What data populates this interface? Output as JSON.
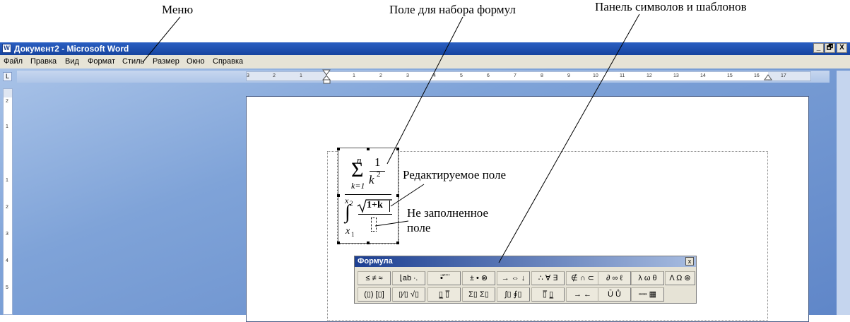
{
  "captions": {
    "menu": "Меню",
    "formula_field": "Поле для набора формул",
    "symbols_panel": "Панель символов и шаблонов",
    "edited_field": "Редактируемое поле",
    "empty_field_line1": "Не заполненное",
    "empty_field_line2": "поле"
  },
  "window": {
    "title": "Документ2 - Microsoft Word",
    "minimize": "_",
    "restore": "🗗",
    "close": "X"
  },
  "menu": {
    "items": [
      "Файл",
      "Правка",
      "Вид",
      "Формат",
      "Стиль",
      "Размер",
      "Окно",
      "Справка"
    ]
  },
  "ruler": {
    "h_numbers": [
      "3",
      "2",
      "1",
      "1",
      "2",
      "3",
      "4",
      "5",
      "6",
      "7",
      "8",
      "9",
      "10",
      "11",
      "12",
      "13",
      "14",
      "15",
      "16",
      "17"
    ],
    "v_numbers": [
      "2",
      "1",
      "1",
      "2",
      "3",
      "4",
      "5"
    ]
  },
  "formula": {
    "sum_symbol": "Σ",
    "sum_upper": "n",
    "sum_lower": "k=1",
    "frac_num": "1",
    "frac_den": "k",
    "frac_den_exp": "2",
    "int_symbol": "∫",
    "int_upper": "x",
    "int_upper_sub": "2",
    "int_lower": "x",
    "int_lower_sub": "1",
    "sqrt_content": "1+k"
  },
  "toolbar": {
    "title": "Формула",
    "close": "x",
    "row1": [
      "≤ ≠ ≈",
      "⌊ab ∙.",
      "∙⃗ ⃛ ⃜",
      "± • ⊗",
      "→ ⇔ ↓",
      "∴ ∀ ∃",
      "∉ ∩ ⊂",
      "∂ ∞ ℓ",
      "λ ω θ",
      "Λ Ω ⊛"
    ],
    "row2": [
      "(▯) [▯]",
      "▯⁄▯ √▯",
      "▯̲ ▯̅",
      "Σ▯ Σ▯",
      "∫▯ ∮▯",
      "▯̅ ▯̲",
      "→ ←",
      "Ū Ů",
      "▫▫▫ ▦"
    ]
  }
}
